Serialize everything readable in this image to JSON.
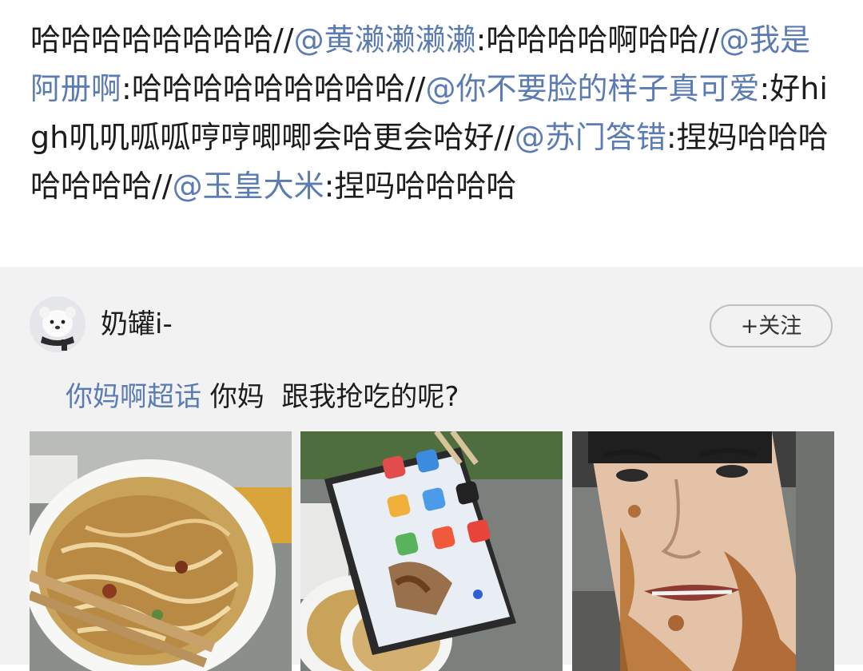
{
  "repost": {
    "segments": [
      {
        "type": "text",
        "text": "哈哈哈哈哈哈哈哈//"
      },
      {
        "type": "mention",
        "text": "@黄濑濑濑濑"
      },
      {
        "type": "text",
        "text": ":哈哈哈哈啊哈哈//"
      },
      {
        "type": "mention",
        "text": "@我是阿册啊"
      },
      {
        "type": "text",
        "text": ":哈哈哈哈哈哈哈哈哈//"
      },
      {
        "type": "mention",
        "text": "@你不要脸的样子真可爱"
      },
      {
        "type": "text",
        "text": ":好high叽叽呱呱哼哼唧唧会哈更会哈好//"
      },
      {
        "type": "mention",
        "text": "@苏门答错"
      },
      {
        "type": "text",
        "text": ":捏妈哈哈哈哈哈哈哈//"
      },
      {
        "type": "mention",
        "text": "@玉皇大米"
      },
      {
        "type": "text",
        "text": ":捏吗哈哈哈哈"
      }
    ]
  },
  "post": {
    "username": "奶罐i-",
    "follow_label": "+关注",
    "topic": "你妈啊超话",
    "body": " 你妈  跟我抢吃的呢?",
    "images": [
      "noodle-bowl-photo",
      "phone-on-noodles-photo",
      "face-on-phone-photo"
    ]
  },
  "colors": {
    "mention": "#5b7bb3",
    "text": "#1c1c1c",
    "card_background": "#f2f2f2"
  }
}
